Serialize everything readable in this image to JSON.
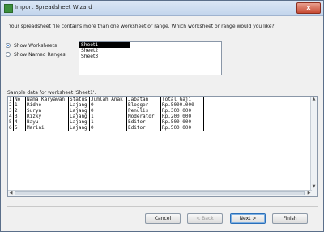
{
  "window": {
    "title": "Import Spreadsheet Wizard",
    "close_glyph": "x"
  },
  "prompt": "Your spreadsheet file contains more than one worksheet or range. Which worksheet or range would you like?",
  "options": {
    "show_worksheets": "Show Worksheets",
    "show_named_ranges": "Show Named Ranges",
    "selected": "show_worksheets"
  },
  "sheets": [
    "Sheet1",
    "Sheet2",
    "Sheet3"
  ],
  "selected_sheet": "Sheet1",
  "sample_label": "Sample data for worksheet 'Sheet1'.",
  "table": {
    "columns": [
      "No",
      "Nama Karyawan",
      "Status",
      "Jumlah Anak",
      "Jabatan",
      "Total Gaji"
    ],
    "rows": [
      [
        "1",
        "Ridho",
        "Lajang",
        "0",
        "Blogger",
        "Rp.5000.000"
      ],
      [
        "2",
        "Surya",
        "Lajang",
        "0",
        "Penulis",
        "Rp.300.000"
      ],
      [
        "3",
        "Rizky",
        "Lajang",
        "1",
        "Moderator",
        "Rp.200.000"
      ],
      [
        "4",
        "Bayu",
        "Lajang",
        "1",
        "Editor",
        "Rp.500.000"
      ],
      [
        "5",
        "Marini",
        "Lajang",
        "0",
        "Editor",
        "Rp.500.000"
      ]
    ],
    "row_numbers": [
      "1",
      "2",
      "3",
      "4",
      "5",
      "6"
    ]
  },
  "buttons": {
    "cancel": "Cancel",
    "back": "< Back",
    "next": "Next >",
    "finish": "Finish"
  }
}
